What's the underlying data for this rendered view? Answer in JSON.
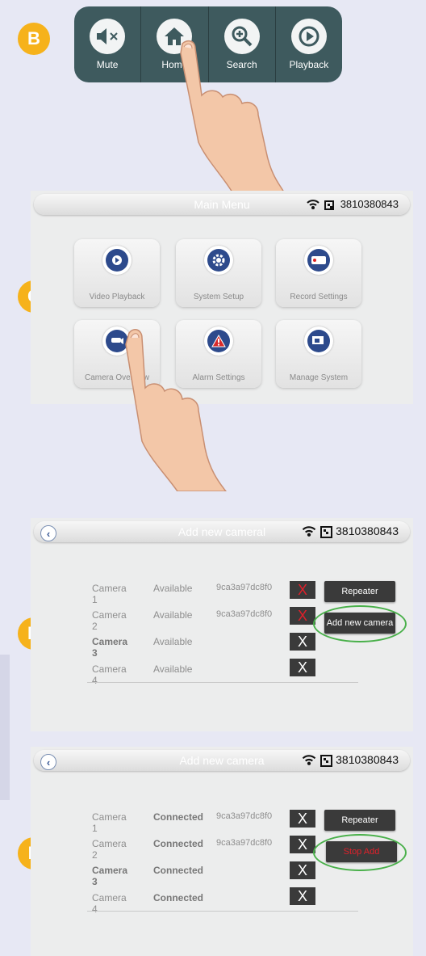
{
  "steps": {
    "b": "B",
    "c": "C",
    "d": "D",
    "e": "E"
  },
  "toolbar": {
    "buttons": [
      {
        "label": "Mute",
        "icon": "mute-icon"
      },
      {
        "label": "Home",
        "icon": "home-icon"
      },
      {
        "label": "Search",
        "icon": "search-icon"
      },
      {
        "label": "Playback",
        "icon": "playback-icon"
      }
    ]
  },
  "main_menu": {
    "title": "Main Menu",
    "device_id": "3810380843",
    "tiles": [
      {
        "label": "Video Playback",
        "icon": "play-icon"
      },
      {
        "label": "System Setup",
        "icon": "gear-icon"
      },
      {
        "label": "Record Settings",
        "icon": "record-icon"
      },
      {
        "label": "Camera Overview",
        "icon": "camera-icon"
      },
      {
        "label": "Alarm Settings",
        "icon": "alarm-icon"
      },
      {
        "label": "Manage System",
        "icon": "manage-icon"
      }
    ]
  },
  "add_camera_d": {
    "title": "Add new cameral",
    "device_id": "3810380843",
    "rows": [
      {
        "name": "Camera 1",
        "status": "Available",
        "id": "9ca3a97dc8f0",
        "x": "X"
      },
      {
        "name": "Camera 2",
        "status": "Available",
        "id": "9ca3a97dc8f0",
        "x": "X"
      },
      {
        "name": "Camera 3",
        "status": "Available",
        "id": "",
        "x": "X"
      },
      {
        "name": "Camera 4",
        "status": "Available",
        "id": "",
        "x": "X"
      }
    ],
    "repeater_label": "Repeater",
    "add_label": "Add new camera"
  },
  "add_camera_e": {
    "title": "Add new camera",
    "device_id": "3810380843",
    "rows": [
      {
        "name": "Camera 1",
        "status": "Connected",
        "id": "9ca3a97dc8f0",
        "x": "X"
      },
      {
        "name": "Camera 2",
        "status": "Connected",
        "id": "9ca3a97dc8f0",
        "x": "X"
      },
      {
        "name": "Camera 3",
        "status": "Connected",
        "id": "",
        "x": "X"
      },
      {
        "name": "Camera 4",
        "status": "Connected",
        "id": "",
        "x": "X"
      }
    ],
    "repeater_label": "Repeater",
    "stop_label": "Stop Add"
  },
  "colors": {
    "badge": "#f6b21b",
    "toolbar": "#3e5a5e",
    "highlight": "#49b04a",
    "stop_text": "#e0202a"
  }
}
